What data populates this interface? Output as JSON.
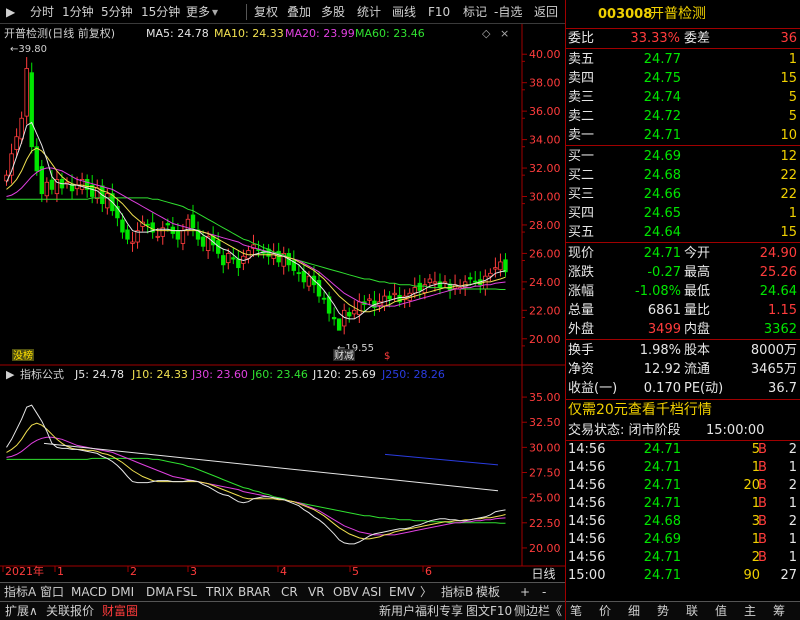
{
  "toolbar": {
    "items": [
      "分时",
      "1分钟",
      "5分钟",
      "15分钟",
      "更多",
      "复权",
      "叠加",
      "多股",
      "统计",
      "画线",
      "F10",
      "标记",
      "-自选",
      "返回"
    ]
  },
  "main_legend": {
    "title": "开普检测(日线 前复权)",
    "ma5": "MA5: 24.78",
    "ma10": "MA10: 24.33",
    "ma20": "MA20: 23.99",
    "ma60": "MA60: 23.46"
  },
  "ind_legend": {
    "title": "指标公式",
    "j5": "J5: 24.78",
    "j10": "J10: 24.33",
    "j30": "J30: 23.60",
    "j60": "J60: 23.46",
    "j120": "J120: 25.69",
    "j250": "J250: 28.26"
  },
  "colors": {
    "up": "#ff3c3c",
    "down": "#00e600",
    "ma5": "#e6e6e6",
    "ma10": "#f0e050",
    "ma20": "#e040e0",
    "ma60": "#30e030",
    "ma120": "#e6e6e6",
    "ma250": "#2a3ce0",
    "axis": "#a00000"
  },
  "annotations": {
    "high": "39.80",
    "low": "19.55",
    "tag_left": "没榜",
    "tag_mid": "财减",
    "tag_red": "$"
  },
  "chart_data": [
    {
      "type": "candlestick",
      "title": "开普检测(日线 前复权)",
      "ylim": [
        19.0,
        41.0
      ],
      "yticks": [
        "40.00",
        "38.00",
        "36.00",
        "34.00",
        "32.00",
        "30.00",
        "28.00",
        "26.00",
        "24.00",
        "22.00",
        "20.00"
      ],
      "ytick_values": [
        40,
        38,
        36,
        34,
        32,
        30,
        28,
        26,
        24,
        22,
        20
      ],
      "high_label": 39.8,
      "low_label": 19.55,
      "closes": [
        31.5,
        33.0,
        34.2,
        35.5,
        39.0,
        33.5,
        31.8,
        30.2,
        31.0,
        30.5,
        31.2,
        30.6,
        31.0,
        30.4,
        30.8,
        31.2,
        30.5,
        30.0,
        30.6,
        29.5,
        30.2,
        29.0,
        28.5,
        27.5,
        27.0,
        26.8,
        27.6,
        28.2,
        28.0,
        27.5,
        27.2,
        27.8,
        28.0,
        27.4,
        27.0,
        27.6,
        28.4,
        27.8,
        27.0,
        26.5,
        27.2,
        26.6,
        26.0,
        25.2,
        26.0,
        25.6,
        25.0,
        25.8,
        26.2,
        26.6,
        26.2,
        26.0,
        25.8,
        26.0,
        25.4,
        26.0,
        25.2,
        24.8,
        24.6,
        24.0,
        24.4,
        23.8,
        23.0,
        22.8,
        21.8,
        21.4,
        20.6,
        22.0,
        21.6,
        22.0,
        22.6,
        22.4,
        22.8,
        22.2,
        22.6,
        23.0,
        22.8,
        23.2,
        22.6,
        23.0,
        23.2,
        23.6,
        23.4,
        23.8,
        24.2,
        24.0,
        23.6,
        24.0,
        23.4,
        23.8,
        23.6,
        24.0,
        24.2,
        24.0,
        23.8,
        24.4,
        24.6,
        25.0,
        25.4,
        24.71
      ],
      "ma5": [
        31.0,
        31.8,
        32.8,
        33.8,
        35.0,
        35.2,
        34.4,
        33.6,
        32.6,
        31.4,
        31.0,
        30.9,
        30.9,
        30.8,
        30.8,
        30.7,
        30.6,
        30.5,
        30.4,
        30.1,
        29.9,
        29.6,
        29.2,
        28.7,
        28.1,
        27.6,
        27.5,
        27.5,
        27.5,
        27.6,
        27.7,
        27.7,
        27.7,
        27.6,
        27.6,
        27.6,
        27.7,
        27.7,
        27.6,
        27.3,
        27.1,
        26.8,
        26.5,
        26.3,
        26.2,
        25.9,
        25.6,
        25.5,
        25.6,
        25.9,
        26.0,
        26.1,
        26.1,
        26.0,
        25.9,
        25.8,
        25.6,
        25.4,
        25.2,
        24.8,
        24.5,
        24.1,
        23.8,
        23.4,
        22.9,
        22.4,
        21.8,
        21.5,
        21.4,
        21.4,
        21.6,
        21.9,
        22.2,
        22.4,
        22.5,
        22.6,
        22.7,
        22.8,
        22.9,
        22.9,
        23.0,
        23.2,
        23.3,
        23.5,
        23.7,
        23.8,
        23.9,
        23.9,
        23.8,
        23.8,
        23.7,
        23.7,
        23.8,
        23.9,
        24.0,
        24.1,
        24.3,
        24.6,
        24.7,
        24.78
      ],
      "ma10": [
        30.5,
        30.8,
        31.2,
        31.8,
        32.6,
        33.2,
        33.4,
        33.2,
        32.8,
        32.3,
        31.8,
        31.4,
        31.1,
        30.9,
        30.8,
        30.8,
        30.7,
        30.7,
        30.6,
        30.4,
        30.3,
        30.1,
        29.8,
        29.5,
        29.1,
        28.7,
        28.4,
        28.1,
        27.9,
        27.7,
        27.6,
        27.6,
        27.6,
        27.6,
        27.6,
        27.6,
        27.6,
        27.6,
        27.6,
        27.5,
        27.4,
        27.2,
        27.0,
        26.8,
        26.6,
        26.4,
        26.2,
        26.0,
        25.9,
        25.9,
        25.9,
        25.9,
        25.9,
        25.9,
        25.8,
        25.8,
        25.7,
        25.6,
        25.4,
        25.2,
        25.0,
        24.8,
        24.5,
        24.2,
        23.8,
        23.4,
        23.0,
        22.7,
        22.4,
        22.2,
        22.0,
        21.9,
        21.9,
        22.0,
        22.1,
        22.3,
        22.4,
        22.6,
        22.7,
        22.8,
        22.9,
        23.0,
        23.1,
        23.2,
        23.3,
        23.4,
        23.5,
        23.6,
        23.6,
        23.7,
        23.7,
        23.8,
        23.8,
        23.9,
        23.9,
        24.0,
        24.0,
        24.1,
        24.2,
        24.33
      ],
      "ma20": [
        30.0,
        30.1,
        30.3,
        30.6,
        31.0,
        31.4,
        31.7,
        31.9,
        32.0,
        32.0,
        31.9,
        31.8,
        31.6,
        31.4,
        31.2,
        31.1,
        31.0,
        30.9,
        30.8,
        30.7,
        30.6,
        30.5,
        30.3,
        30.1,
        29.9,
        29.7,
        29.5,
        29.3,
        29.1,
        28.9,
        28.7,
        28.5,
        28.3,
        28.1,
        28.0,
        27.9,
        27.8,
        27.7,
        27.6,
        27.5,
        27.4,
        27.3,
        27.2,
        27.1,
        27.0,
        26.9,
        26.8,
        26.6,
        26.5,
        26.4,
        26.3,
        26.2,
        26.1,
        26.0,
        25.9,
        25.8,
        25.7,
        25.6,
        25.5,
        25.3,
        25.1,
        24.9,
        24.7,
        24.4,
        24.1,
        23.8,
        23.5,
        23.2,
        23.0,
        22.8,
        22.6,
        22.5,
        22.4,
        22.3,
        22.3,
        22.3,
        22.3,
        22.3,
        22.4,
        22.5,
        22.6,
        22.7,
        22.8,
        22.9,
        23.0,
        23.1,
        23.2,
        23.3,
        23.4,
        23.5,
        23.5,
        23.6,
        23.6,
        23.7,
        23.7,
        23.8,
        23.8,
        23.9,
        23.95,
        23.99
      ],
      "ma60": [
        29.8,
        29.8,
        29.8,
        29.8,
        29.8,
        29.8,
        29.8,
        29.8,
        29.8,
        29.8,
        29.8,
        29.8,
        29.8,
        29.8,
        29.8,
        29.8,
        29.8,
        29.9,
        29.9,
        29.9,
        29.9,
        29.9,
        29.9,
        29.9,
        29.9,
        29.9,
        29.9,
        29.9,
        29.9,
        29.8,
        29.8,
        29.7,
        29.6,
        29.5,
        29.4,
        29.3,
        29.1,
        29.0,
        28.8,
        28.6,
        28.4,
        28.2,
        28.0,
        27.8,
        27.6,
        27.4,
        27.2,
        27.0,
        26.9,
        26.7,
        26.6,
        26.4,
        26.3,
        26.1,
        26.0,
        25.9,
        25.7,
        25.6,
        25.5,
        25.4,
        25.3,
        25.2,
        25.1,
        25.0,
        24.9,
        24.8,
        24.7,
        24.6,
        24.5,
        24.4,
        24.3,
        24.2,
        24.2,
        24.1,
        24.0,
        24.0,
        23.9,
        23.9,
        23.8,
        23.8,
        23.8,
        23.7,
        23.7,
        23.7,
        23.6,
        23.6,
        23.6,
        23.6,
        23.5,
        23.5,
        23.5,
        23.5,
        23.5,
        23.5,
        23.5,
        23.5,
        23.5,
        23.5,
        23.46,
        23.46
      ]
    },
    {
      "type": "line",
      "title": "指标公式",
      "ylim": [
        19.0,
        36.5
      ],
      "yticks": [
        "35.00",
        "32.50",
        "30.00",
        "27.50",
        "25.00",
        "22.50",
        "20.00"
      ],
      "ytick_values": [
        35,
        32.5,
        30,
        27.5,
        25,
        22.5,
        20
      ],
      "x": [
        "2021年",
        "1",
        "2",
        "3",
        "4",
        "5",
        "6"
      ],
      "j120_start": 30.4,
      "j120_end": 25.69,
      "j250_start": 29.3,
      "j250_end": 28.26
    }
  ],
  "quote": {
    "code": "003008",
    "name": "开普检测",
    "weibi_label": "委比",
    "weibi": "33.33%",
    "weicha_label": "委差",
    "weicha": "36",
    "asks": [
      {
        "label": "卖五",
        "price": "24.77",
        "vol": "1"
      },
      {
        "label": "卖四",
        "price": "24.75",
        "vol": "15"
      },
      {
        "label": "卖三",
        "price": "24.74",
        "vol": "5"
      },
      {
        "label": "卖二",
        "price": "24.72",
        "vol": "5"
      },
      {
        "label": "卖一",
        "price": "24.71",
        "vol": "10"
      }
    ],
    "bids": [
      {
        "label": "买一",
        "price": "24.69",
        "vol": "12"
      },
      {
        "label": "买二",
        "price": "24.68",
        "vol": "22"
      },
      {
        "label": "买三",
        "price": "24.66",
        "vol": "22"
      },
      {
        "label": "买四",
        "price": "24.65",
        "vol": "1"
      },
      {
        "label": "买五",
        "price": "24.64",
        "vol": "15"
      }
    ],
    "stats": [
      {
        "l1": "现价",
        "v1": "24.71",
        "c1": "grn",
        "l2": "今开",
        "v2": "24.90",
        "c2": "red"
      },
      {
        "l1": "涨跌",
        "v1": "-0.27",
        "c1": "grn",
        "l2": "最高",
        "v2": "25.26",
        "c2": "red"
      },
      {
        "l1": "涨幅",
        "v1": "-1.08%",
        "c1": "grn",
        "l2": "最低",
        "v2": "24.64",
        "c2": "grn"
      },
      {
        "l1": "总量",
        "v1": "6861",
        "c1": "wht",
        "l2": "量比",
        "v2": "1.15",
        "c2": "red"
      },
      {
        "l1": "外盘",
        "v1": "3499",
        "c1": "red",
        "l2": "内盘",
        "v2": "3362",
        "c2": "grn"
      }
    ],
    "stats2": [
      {
        "l1": "换手",
        "v1": "1.98%",
        "l2": "股本",
        "v2": "8000万"
      },
      {
        "l1": "净资",
        "v1": "12.92",
        "l2": "流通",
        "v2": "3465万"
      },
      {
        "l1": "收益(一)",
        "v1": "0.170",
        "l2": "PE(动)",
        "v2": "36.7"
      }
    ],
    "promo": "仅需20元查看千档行情",
    "status_label": "交易状态: 闭市阶段",
    "status_time": "15:00:00",
    "ticks": [
      {
        "t": "14:56",
        "p": "24.71",
        "v": "5",
        "d": "B",
        "n": "2"
      },
      {
        "t": "14:56",
        "p": "24.71",
        "v": "1",
        "d": "B",
        "n": "1"
      },
      {
        "t": "14:56",
        "p": "24.71",
        "v": "20",
        "d": "B",
        "n": "2"
      },
      {
        "t": "14:56",
        "p": "24.71",
        "v": "1",
        "d": "B",
        "n": "1"
      },
      {
        "t": "14:56",
        "p": "24.68",
        "v": "3",
        "d": "B",
        "n": "2"
      },
      {
        "t": "14:56",
        "p": "24.69",
        "v": "1",
        "d": "B",
        "n": "1"
      },
      {
        "t": "14:56",
        "p": "24.71",
        "v": "2",
        "d": "B",
        "n": "1"
      },
      {
        "t": "15:00",
        "p": "24.71",
        "v": "90",
        "d": "",
        "n": "27"
      }
    ]
  },
  "bottom_tabs": [
    "指标A",
    "窗口",
    "MACD",
    "DMI",
    "DMA",
    "FSL",
    "TRIX",
    "BRAR",
    "CR",
    "VR",
    "OBV",
    "ASI",
    "EMV",
    "〉",
    "指标B",
    "模板",
    "+",
    "-"
  ],
  "period": "日线",
  "status_bar": {
    "left": [
      "扩展∧",
      "关联报价",
      "财富圈"
    ],
    "mid": [
      "新用户福利专享",
      "图文F10",
      "侧边栏《"
    ],
    "right": [
      "笔",
      "价",
      "细",
      "势",
      "联",
      "值",
      "主",
      "筹"
    ]
  }
}
